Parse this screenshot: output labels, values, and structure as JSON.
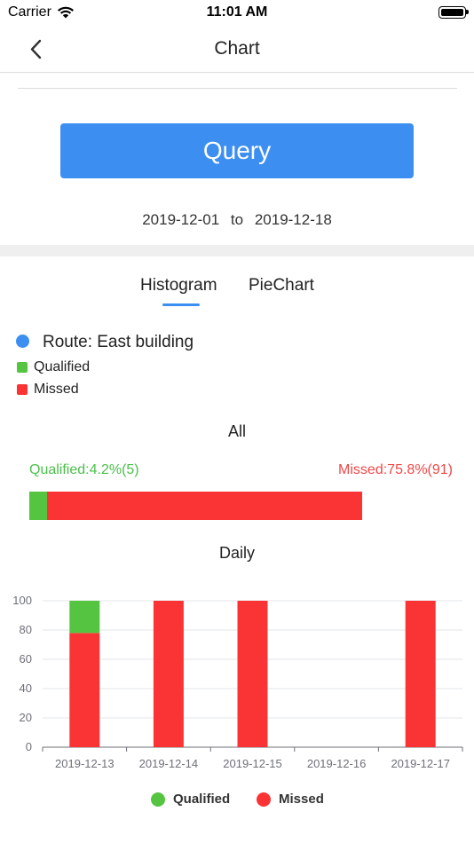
{
  "status_bar": {
    "carrier": "Carrier",
    "time": "11:01 AM"
  },
  "nav": {
    "title": "Chart",
    "back_icon": "chevron-left-icon"
  },
  "query": {
    "button_label": "Query",
    "date_from": "2019-12-01",
    "date_separator": "to",
    "date_to": "2019-12-18"
  },
  "tabs": [
    {
      "label": "Histogram",
      "selected": true
    },
    {
      "label": "PieChart",
      "selected": false
    }
  ],
  "route": {
    "label": "Route: East building"
  },
  "legend": [
    {
      "label": "Qualified",
      "color": "#55c440"
    },
    {
      "label": "Missed",
      "color": "#fa3434"
    }
  ],
  "summary": {
    "title": "All",
    "qualified_text": "Qualified:4.2%(5)",
    "missed_text": "Missed:75.8%(91)",
    "qualified_pct": 4.2,
    "missed_pct": 75.8
  },
  "daily": {
    "title": "Daily"
  },
  "chart_data": {
    "type": "bar",
    "stacked": true,
    "categories": [
      "2019-12-13",
      "2019-12-14",
      "2019-12-15",
      "2019-12-16",
      "2019-12-17"
    ],
    "series": [
      {
        "name": "Missed",
        "values": [
          78,
          100,
          100,
          0,
          100
        ],
        "color": "#fa3434"
      },
      {
        "name": "Qualified",
        "values": [
          22,
          0,
          0,
          0,
          0
        ],
        "color": "#55c440"
      }
    ],
    "yticks": [
      0,
      20,
      40,
      60,
      80,
      100
    ],
    "ylim": [
      0,
      100
    ],
    "grid": true,
    "legend": "bottom"
  }
}
